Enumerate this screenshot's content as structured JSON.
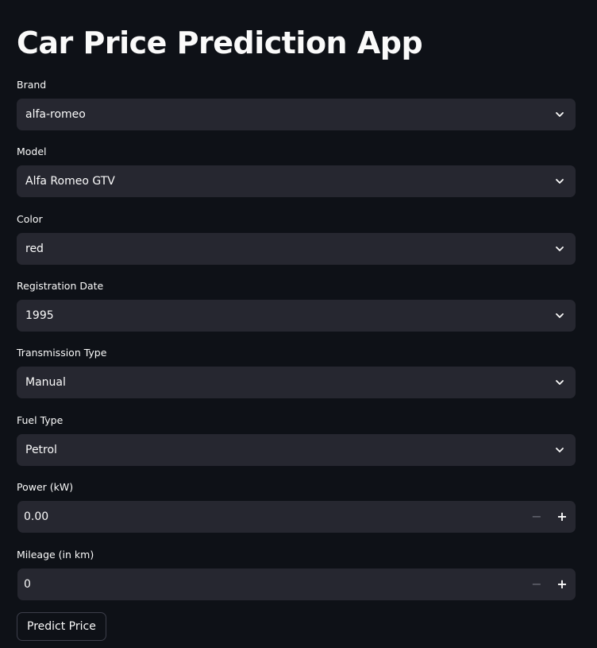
{
  "app": {
    "title": "Car Price Prediction App"
  },
  "fields": {
    "brand": {
      "label": "Brand",
      "value": "alfa-romeo"
    },
    "model": {
      "label": "Model",
      "value": "Alfa Romeo GTV"
    },
    "color": {
      "label": "Color",
      "value": "red"
    },
    "registration_date": {
      "label": "Registration Date",
      "value": "1995"
    },
    "transmission_type": {
      "label": "Transmission Type",
      "value": "Manual"
    },
    "fuel_type": {
      "label": "Fuel Type",
      "value": "Petrol"
    },
    "power": {
      "label": "Power (kW)",
      "value": "0.00",
      "decrement": "−",
      "increment": "+"
    },
    "mileage": {
      "label": "Mileage (in km)",
      "value": "0",
      "decrement": "−",
      "increment": "+"
    }
  },
  "actions": {
    "predict_label": "Predict Price"
  },
  "icons": {
    "dropdown": "chevron-down-icon",
    "minus": "minus-icon",
    "plus": "plus-icon"
  },
  "colors": {
    "background": "#0e1117",
    "input_background": "#262730",
    "text": "#fafafa",
    "muted": "#6b6d76",
    "button_border": "#3d3f4b"
  }
}
